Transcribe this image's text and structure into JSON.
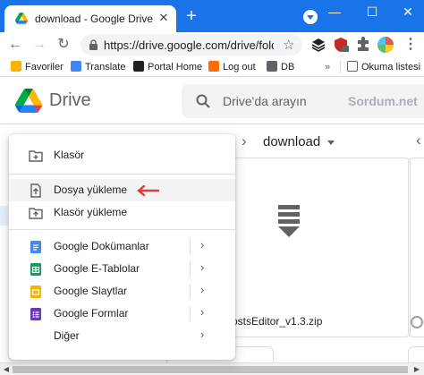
{
  "browser": {
    "tab_title": "download - Google Drive",
    "url": "https://drive.google.com/drive/folder...",
    "accent_color": "#1a73e8"
  },
  "bookmarks": [
    {
      "label": "Favoriler",
      "icon": "folder-icon",
      "color": "#f4b400"
    },
    {
      "label": "Translate",
      "icon": "translate-icon",
      "color": "#4285f4"
    },
    {
      "label": "Portal Home",
      "icon": "portal-icon",
      "color": "#202124"
    },
    {
      "label": "Log out",
      "icon": "logout-icon",
      "color": "#ff6d00"
    },
    {
      "label": "DB",
      "icon": "db-icon",
      "color": "#5f6368"
    },
    {
      "label": "Okuma listesi",
      "icon": "reading-list-icon",
      "color": "#5f6368"
    }
  ],
  "drive": {
    "brand": "Drive",
    "search_placeholder": "Drive'da arayın",
    "watermark": "Sordum.net",
    "breadcrumb": "download",
    "file_name": "ostsEditor_v1.3.zip"
  },
  "new_menu": {
    "items": [
      {
        "label": "Klasör",
        "icon": "new-folder-icon"
      },
      {
        "label": "Dosya yükleme",
        "icon": "file-upload-icon",
        "highlighted": true
      },
      {
        "label": "Klasör yükleme",
        "icon": "folder-upload-icon"
      },
      {
        "label": "Google Dokümanlar",
        "icon": "google-docs-icon",
        "color": "#4285f4",
        "submenu": true
      },
      {
        "label": "Google E-Tablolar",
        "icon": "google-sheets-icon",
        "color": "#0f9d58",
        "submenu": true
      },
      {
        "label": "Google Slaytlar",
        "icon": "google-slides-icon",
        "color": "#f4b400",
        "submenu": true
      },
      {
        "label": "Google Formlar",
        "icon": "google-forms-icon",
        "color": "#673ab7",
        "submenu": true
      },
      {
        "label": "Diğer",
        "icon": "more-icon",
        "submenu": true
      }
    ],
    "annotation_color": "#e53935"
  }
}
